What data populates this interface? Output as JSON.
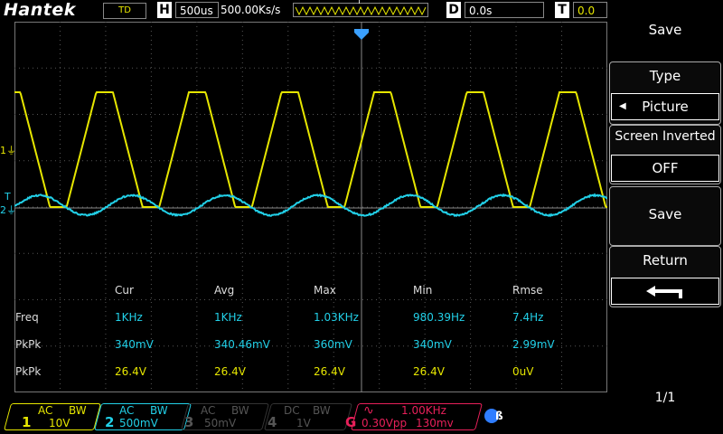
{
  "header": {
    "brand": "Hantek",
    "mode": "TD",
    "h_letter": "H",
    "timebase": "500us",
    "sample_rate": "500.00Ks/s",
    "trigger_marker": "T",
    "d_letter": "D",
    "delay": "0.0s",
    "t_letter": "T",
    "trigger_value": "0.0"
  },
  "menu": {
    "title": "Save",
    "type_label": "Type",
    "type_value": "Picture",
    "screen_inverted_label": "Screen Inverted",
    "screen_inverted_value": "OFF",
    "save_label": "Save",
    "return_label": "Return",
    "page": "1/1"
  },
  "screen": {
    "ch1_marker": "1",
    "ch2_marker": "2",
    "trig_marker": "T"
  },
  "measurements": {
    "headers": [
      "Cur",
      "Avg",
      "Max",
      "Min",
      "Rmse"
    ],
    "rows": [
      {
        "label": "Freq",
        "values": [
          "1KHz",
          "1KHz",
          "1.03KHz",
          "980.39Hz",
          "7.4Hz"
        ],
        "channel": "ch2"
      },
      {
        "label": "PkPk",
        "values": [
          "340mV",
          "340.46mV",
          "360mV",
          "340mV",
          "2.99mV"
        ],
        "channel": "ch2"
      },
      {
        "label": "PkPk",
        "values": [
          "26.4V",
          "26.4V",
          "26.4V",
          "26.4V",
          "0uV"
        ],
        "channel": "ch1"
      }
    ]
  },
  "channels": [
    {
      "num": "1",
      "coupling": "AC",
      "bw": "BW",
      "scale": "10V",
      "color": "#e6e600",
      "active": true
    },
    {
      "num": "2",
      "coupling": "AC",
      "bw": "BW",
      "scale": "500mV",
      "color": "#22d0e8",
      "active": true
    },
    {
      "num": "3",
      "coupling": "AC",
      "bw": "BW",
      "scale": "50mV",
      "color": "#555555",
      "active": false
    },
    {
      "num": "4",
      "coupling": "DC",
      "bw": "BW",
      "scale": "1V",
      "color": "#555555",
      "active": false
    }
  ],
  "generator": {
    "label": "G",
    "freq": "1.00KHz",
    "amplitude": "0.30Vpp",
    "offset": "130mv",
    "color": "#e8205a"
  },
  "colors": {
    "ch1": "#e6e600",
    "ch2": "#22d0e8",
    "grid": "#666666",
    "trigger": "#3aa0ff"
  }
}
